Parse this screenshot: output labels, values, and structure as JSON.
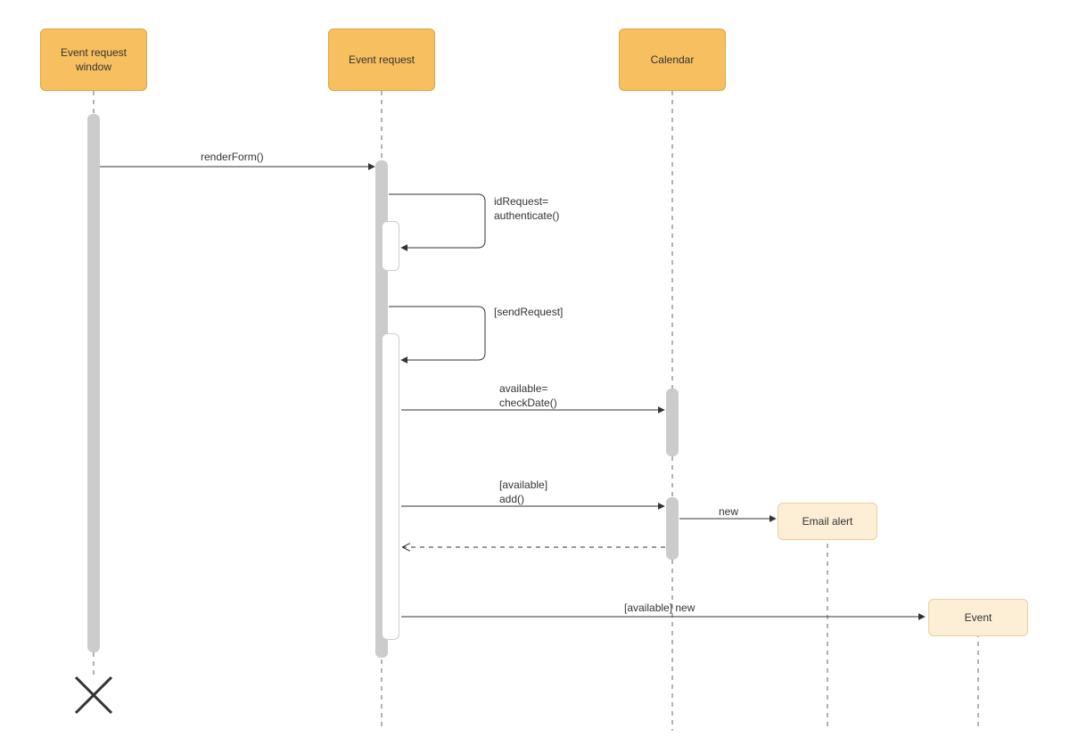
{
  "participants": {
    "p1": "Event request\nwindow",
    "p2": "Event request",
    "p3": "Calendar",
    "side_email": "Email alert",
    "side_event": "Event"
  },
  "messages": {
    "renderForm": "renderForm()",
    "auth": "idRequest=\nauthenticate()",
    "sendRequest": "[sendRequest]",
    "checkDate": "available=\ncheckDate()",
    "add": "[available]\nadd()",
    "newEmail": "new",
    "availableNew": "[available] new"
  }
}
